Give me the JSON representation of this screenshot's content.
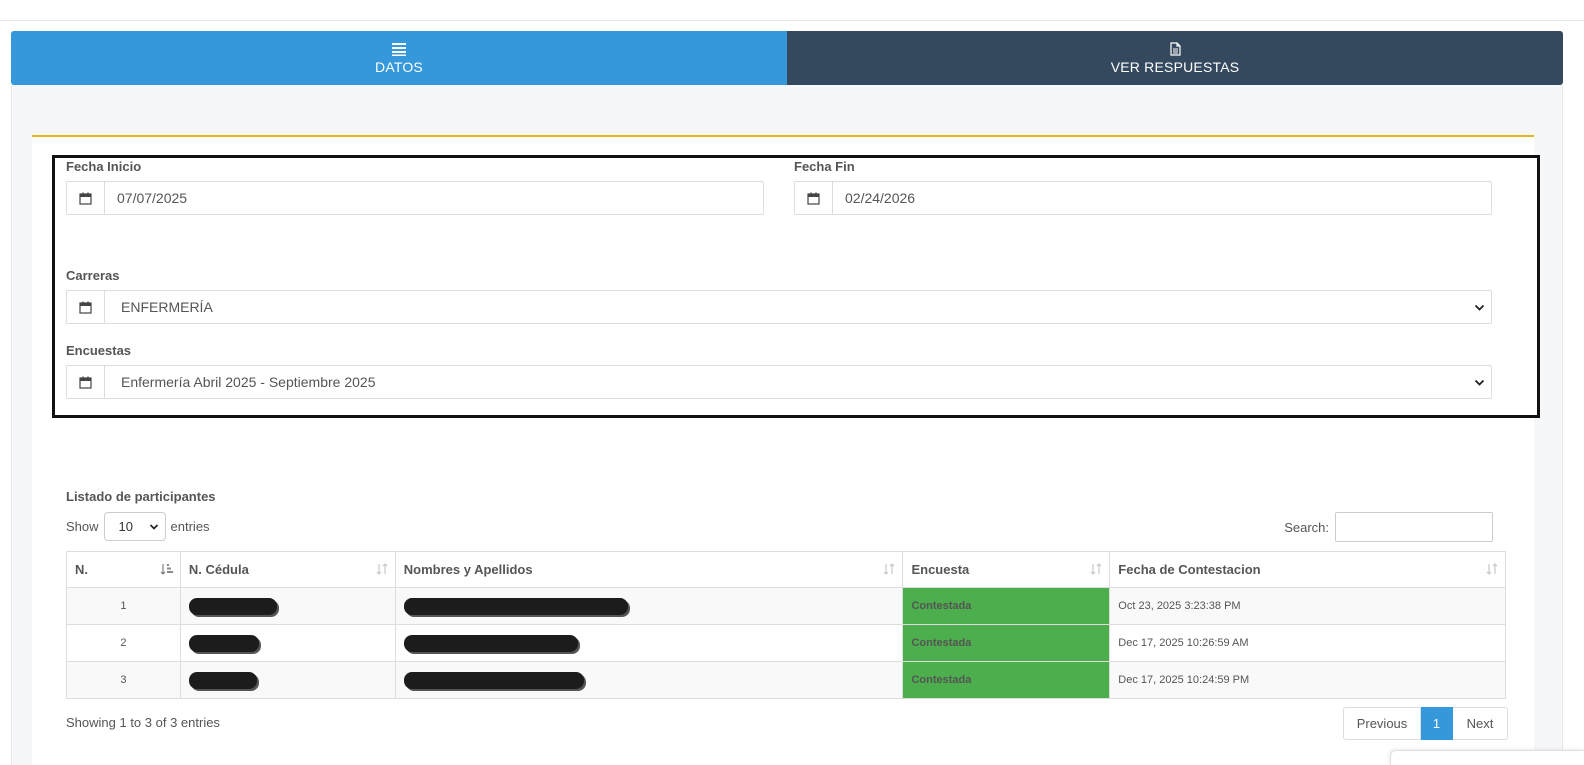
{
  "tabs": [
    {
      "label": "DATOS",
      "icon": "list-icon",
      "color": "#3498db"
    },
    {
      "label": "VER RESPUESTAS",
      "icon": "file-icon",
      "color": "#34495e"
    }
  ],
  "filters": {
    "fecha_inicio": {
      "label": "Fecha Inicio",
      "value": "07/07/2025",
      "icon": "calendar-icon"
    },
    "fecha_fin": {
      "label": "Fecha Fin",
      "value": "02/24/2026",
      "icon": "calendar-icon"
    },
    "carreras": {
      "label": "Carreras",
      "selected": "ENFERMERÍA",
      "icon": "calendar-icon"
    },
    "encuestas": {
      "label": "Encuestas",
      "selected": "Enfermería Abril 2025 - Septiembre 2025",
      "icon": "calendar-icon"
    }
  },
  "table_section": {
    "title": "Listado de participantes",
    "show_label": "Show",
    "entries_value": "10",
    "entries_label": "entries",
    "search_label": "Search:",
    "columns": [
      "N.",
      "N. Cédula",
      "Nombres y Apellidos",
      "Encuesta",
      "Fecha de Contestacion"
    ],
    "rows": [
      {
        "n": "1",
        "cedula": "",
        "nombres": "",
        "encuesta": "Contestada",
        "fecha": "Oct 23, 2025 3:23:38 PM"
      },
      {
        "n": "2",
        "cedula": "",
        "nombres": "",
        "encuesta": "Contestada",
        "fecha": "Dec 17, 2025 10:26:59 AM"
      },
      {
        "n": "3",
        "cedula": "",
        "nombres": "",
        "encuesta": "Contestada",
        "fecha": "Dec 17, 2025 10:24:59 PM"
      }
    ],
    "status_color": "#4cae4c",
    "info": "Showing 1 to 3 of 3 entries",
    "pagination": {
      "previous": "Previous",
      "current": "1",
      "next": "Next"
    }
  },
  "colors": {
    "accent": "#3498db",
    "dark": "#34495e",
    "divider": "#e4b61a"
  }
}
